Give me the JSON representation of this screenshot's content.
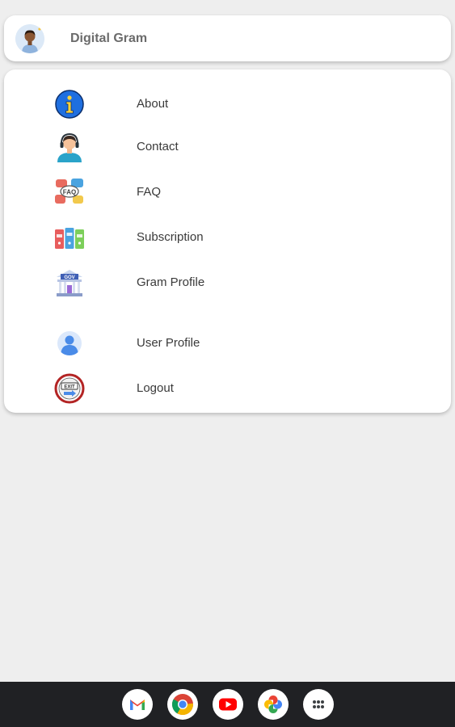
{
  "header": {
    "app_title": "Digital Gram",
    "avatar_icon": "user-avatar-icon"
  },
  "menu": {
    "items": [
      {
        "label": "About",
        "icon": "info-icon"
      },
      {
        "label": "Contact",
        "icon": "support-agent-icon"
      },
      {
        "label": "FAQ",
        "icon": "faq-chat-icon"
      },
      {
        "label": "Subscription",
        "icon": "binders-icon"
      },
      {
        "label": "Gram Profile",
        "icon": "gov-building-icon"
      },
      {
        "label": "User Profile",
        "icon": "user-profile-icon"
      },
      {
        "label": "Logout",
        "icon": "exit-icon"
      }
    ]
  },
  "taskbar": {
    "apps": [
      {
        "name": "Gmail",
        "icon": "gmail-icon"
      },
      {
        "name": "Chrome",
        "icon": "chrome-icon"
      },
      {
        "name": "YouTube",
        "icon": "youtube-icon"
      },
      {
        "name": "Photos",
        "icon": "photos-icon"
      },
      {
        "name": "Launcher",
        "icon": "app-launcher-icon"
      }
    ]
  },
  "colors": {
    "background": "#eeeeee",
    "card": "#ffffff",
    "taskbar": "#202124",
    "label_text": "#3a3a3a",
    "title_text": "#6b6b6b"
  }
}
